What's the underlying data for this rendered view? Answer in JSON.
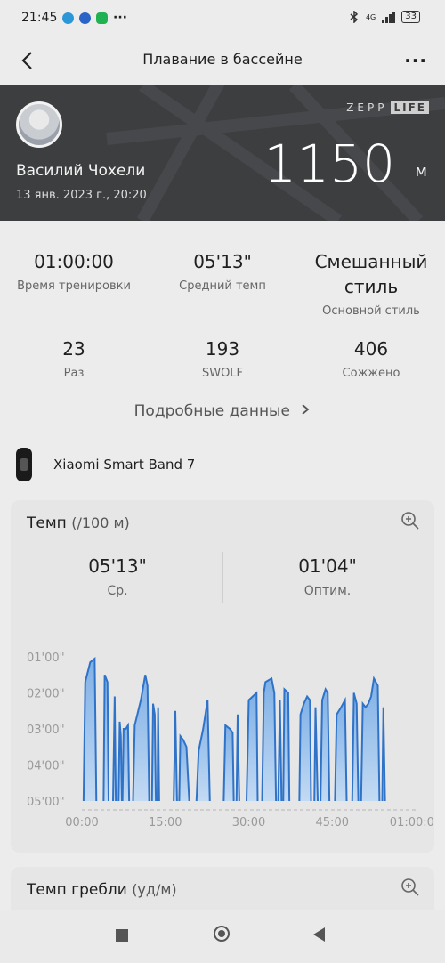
{
  "status": {
    "time": "21:45",
    "dots": "···",
    "net_label": "4G",
    "battery": "33"
  },
  "topbar": {
    "title": "Плавание в бассейне",
    "more": "···"
  },
  "hero": {
    "name": "Василий Чохели",
    "date": "13 янв. 2023 г., 20:20",
    "brand_zepp": "ZEPP",
    "brand_life": "LIFE",
    "distance": "1150",
    "unit": "м"
  },
  "stats": {
    "duration": {
      "value": "01:00:00",
      "label": "Время тренировки"
    },
    "pace": {
      "value": "05'13\"",
      "label": "Средний темп"
    },
    "style": {
      "value_line1": "Смешанный",
      "value_line2": "стиль",
      "label": "Основной стиль"
    },
    "laps": {
      "value": "23",
      "label": "Раз"
    },
    "swolf": {
      "value": "193",
      "label": "SWOLF"
    },
    "calories": {
      "value": "406",
      "label": "Сожжено"
    }
  },
  "details_link": "Подробные данные",
  "device": {
    "name": "Xiaomi Smart Band 7"
  },
  "pace_card": {
    "title": "Темп",
    "subtitle": "(/100 м)",
    "avg_value": "05'13\"",
    "avg_label": "Ср.",
    "opt_value": "01'04\"",
    "opt_label": "Оптим."
  },
  "stroke_card": {
    "title": "Темп гребли",
    "subtitle": "(уд/м)"
  },
  "colors": {
    "accent": "#2f73c8",
    "hero_bg": "#3d3e40"
  },
  "chart_data": {
    "type": "area",
    "title": "",
    "xlabel": "",
    "ylabel": "",
    "x_ticks": [
      "00:00",
      "15:00",
      "30:00",
      "45:00",
      "01:00:00"
    ],
    "y_ticks": [
      "01'00\"",
      "02'00\"",
      "03'00\"",
      "04'00\"",
      "05'00\""
    ],
    "ylim_minutes": [
      1,
      5
    ],
    "xlim_minutes": [
      0,
      60
    ],
    "segments": [
      [
        [
          0.3,
          5.0
        ],
        [
          0.6,
          1.7
        ],
        [
          1.5,
          1.15
        ],
        [
          2.3,
          1.05
        ],
        [
          2.6,
          5.0
        ]
      ],
      [
        [
          3.9,
          5.0
        ],
        [
          4.1,
          1.5
        ],
        [
          4.6,
          1.7
        ],
        [
          4.8,
          5.0
        ]
      ],
      [
        [
          5.6,
          5.0
        ],
        [
          5.9,
          2.1
        ],
        [
          6.1,
          5.0
        ]
      ],
      [
        [
          6.6,
          5.0
        ],
        [
          6.8,
          2.8
        ],
        [
          7.0,
          3.2
        ],
        [
          7.2,
          5.0
        ]
      ],
      [
        [
          7.3,
          5.0
        ],
        [
          7.5,
          3.0
        ],
        [
          7.9,
          3.0
        ],
        [
          8.3,
          2.9
        ],
        [
          8.5,
          5.0
        ]
      ],
      [
        [
          9.2,
          5.0
        ],
        [
          9.5,
          2.9
        ],
        [
          10.6,
          2.2
        ],
        [
          11.4,
          1.5
        ],
        [
          11.8,
          1.8
        ],
        [
          12.1,
          5.0
        ]
      ],
      [
        [
          12.6,
          5.0
        ],
        [
          12.8,
          2.3
        ],
        [
          13.1,
          2.6
        ],
        [
          13.3,
          5.0
        ]
      ],
      [
        [
          13.6,
          5.0
        ],
        [
          13.7,
          2.4
        ],
        [
          13.9,
          5.0
        ]
      ],
      [
        [
          16.5,
          5.0
        ],
        [
          16.8,
          2.5
        ],
        [
          17.1,
          5.0
        ]
      ],
      [
        [
          17.5,
          5.0
        ],
        [
          17.7,
          3.2
        ],
        [
          18.2,
          3.3
        ],
        [
          18.8,
          3.5
        ],
        [
          19.3,
          5.0
        ]
      ],
      [
        [
          20.6,
          5.0
        ],
        [
          21.0,
          3.6
        ],
        [
          21.8,
          3.0
        ],
        [
          22.6,
          2.2
        ],
        [
          23.0,
          5.0
        ]
      ],
      [
        [
          25.5,
          5.0
        ],
        [
          25.8,
          2.9
        ],
        [
          26.6,
          3.0
        ],
        [
          27.1,
          3.1
        ],
        [
          27.3,
          5.0
        ]
      ],
      [
        [
          27.8,
          5.0
        ],
        [
          28.0,
          2.6
        ],
        [
          28.3,
          5.0
        ]
      ],
      [
        [
          29.6,
          5.0
        ],
        [
          30.0,
          2.2
        ],
        [
          31.4,
          2.0
        ],
        [
          31.6,
          5.0
        ]
      ],
      [
        [
          32.4,
          5.0
        ],
        [
          32.7,
          2.0
        ],
        [
          33.0,
          1.7
        ],
        [
          34.1,
          1.6
        ],
        [
          34.6,
          2.0
        ],
        [
          34.9,
          5.0
        ]
      ],
      [
        [
          35.3,
          5.0
        ],
        [
          35.6,
          2.2
        ],
        [
          35.9,
          5.0
        ]
      ],
      [
        [
          36.2,
          5.0
        ],
        [
          36.4,
          1.9
        ],
        [
          37.1,
          2.0
        ],
        [
          37.3,
          5.0
        ]
      ],
      [
        [
          39.1,
          5.0
        ],
        [
          39.3,
          2.6
        ],
        [
          39.9,
          2.3
        ],
        [
          40.5,
          2.1
        ],
        [
          41.0,
          2.2
        ],
        [
          41.2,
          5.0
        ]
      ],
      [
        [
          41.8,
          5.0
        ],
        [
          42.0,
          2.4
        ],
        [
          42.4,
          5.0
        ]
      ],
      [
        [
          42.9,
          5.0
        ],
        [
          43.2,
          2.2
        ],
        [
          43.8,
          1.9
        ],
        [
          44.2,
          2.0
        ],
        [
          44.5,
          5.0
        ]
      ],
      [
        [
          45.5,
          5.0
        ],
        [
          45.8,
          2.6
        ],
        [
          46.6,
          2.4
        ],
        [
          47.3,
          2.2
        ],
        [
          47.6,
          5.0
        ]
      ],
      [
        [
          48.6,
          5.0
        ],
        [
          48.9,
          2.0
        ],
        [
          49.4,
          2.3
        ],
        [
          49.7,
          5.0
        ]
      ],
      [
        [
          50.2,
          5.0
        ],
        [
          50.5,
          2.3
        ],
        [
          51.0,
          2.4
        ],
        [
          51.5,
          2.3
        ],
        [
          52.0,
          2.1
        ],
        [
          52.5,
          1.6
        ],
        [
          53.2,
          1.8
        ],
        [
          53.5,
          5.0
        ]
      ],
      [
        [
          54.0,
          5.0
        ],
        [
          54.2,
          2.4
        ],
        [
          54.5,
          5.0
        ]
      ]
    ]
  }
}
